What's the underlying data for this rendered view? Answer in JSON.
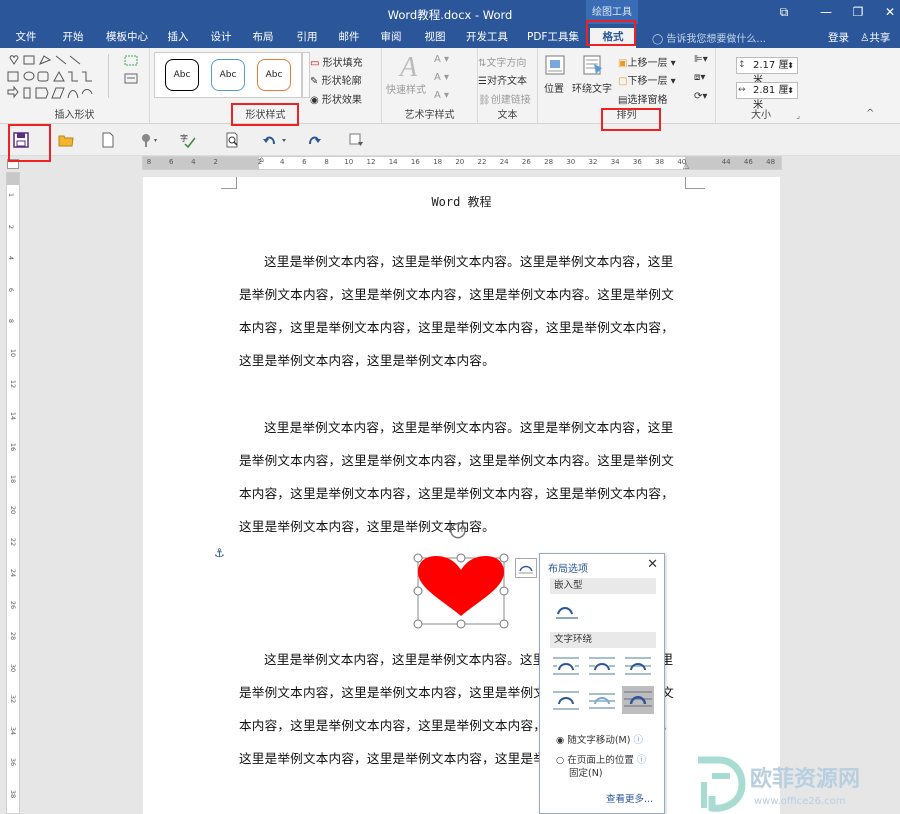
{
  "window": {
    "title": "Word教程.docx - Word",
    "contextual_tools": "绘图工具",
    "minimize": "—",
    "restore": "❐",
    "close": "✕",
    "ribbon_display": "⧉"
  },
  "tabs": [
    {
      "label": "文件"
    },
    {
      "label": "开始"
    },
    {
      "label": "模板中心"
    },
    {
      "label": "插入"
    },
    {
      "label": "设计"
    },
    {
      "label": "布局"
    },
    {
      "label": "引用"
    },
    {
      "label": "邮件"
    },
    {
      "label": "审阅"
    },
    {
      "label": "视图"
    },
    {
      "label": "开发工具"
    },
    {
      "label": "PDF工具集"
    },
    {
      "label": "格式"
    }
  ],
  "tell_me": "告诉我您想要做什么...",
  "account": {
    "login": "登录",
    "share": "共享"
  },
  "ribbon": {
    "insert_shapes": {
      "label": "插入形状"
    },
    "shape_styles": {
      "label": "形状样式",
      "style_preview": "Abc",
      "fill": "形状填充",
      "outline": "形状轮廓",
      "effects": "形状效果"
    },
    "wordart": {
      "label": "艺术字样式",
      "quick_styles": "快速样式"
    },
    "text": {
      "label": "文本",
      "direction": "文字方向",
      "align": "对齐文本",
      "link": "创建链接"
    },
    "arrange": {
      "label": "排列",
      "position": "位置",
      "wrap_text": "环绕文字",
      "bring_forward": "上移一层",
      "send_backward": "下移一层",
      "selection_pane": "选择窗格"
    },
    "size": {
      "label": "大小",
      "height": "2.17 厘米",
      "width": "2.81 厘米"
    }
  },
  "ruler": {
    "h_ticks": [
      "8",
      "6",
      "4",
      "2",
      "",
      "2",
      "4",
      "6",
      "8",
      "10",
      "12",
      "14",
      "16",
      "18",
      "20",
      "22",
      "24",
      "26",
      "28",
      "30",
      "32",
      "34",
      "36",
      "38",
      "40",
      "",
      "44",
      "46",
      "48"
    ],
    "v_ticks": [
      "1",
      "2",
      "4",
      "6",
      "8",
      "10",
      "12",
      "14",
      "16",
      "18",
      "20",
      "22",
      "24",
      "26",
      "28",
      "30",
      "32",
      "34",
      "36",
      "38"
    ]
  },
  "document": {
    "header": "Word 教程",
    "lines": [
      "这里是举例文本内容，这里是举例文本内容。这里是举例文本内容，这里",
      "是举例文本内容，这里是举例文本内容，这里是举例文本内容。这里是举例文",
      "本内容，这里是举例文本内容，这里是举例文本内容，这里是举例文本内容，",
      "这里是举例文本内容，这里是举例文本内容。",
      "这里是举例文本内容，这里是举例文本内容。这里是举例文本内容，这里",
      "是举例文本内容，这里是举例文本内容，这里是举例文本内容。这里是举例文",
      "本内容，这里是举例文本内容，这里是举例文本内容，这里是举例文本内容，",
      "这里是举例文本内容，这里是举例文本内容。",
      "这里是举例文本内容，这里是举例文本内容。这里是举例文本内容，这里",
      "是举例文本内容，这里是举例文本内容，这里是举例文本内容。这里是举例文",
      "本内容，这里是举例文本内容，这里是举例文本内容，这里是举例文本内容，",
      "这里是举例文本内容，这里是举例文本内容，这里是举例文本内容，"
    ]
  },
  "layout_options": {
    "title": "布局选项",
    "close": "✕",
    "inline_section": "嵌入型",
    "wrap_section": "文字环绕",
    "move_with_text": "随文字移动(M)",
    "fix_position_line1": "在页面上的位置",
    "fix_position_line2": "固定(N)",
    "see_more": "查看更多..."
  },
  "watermark": {
    "brand": "欧菲资源网",
    "url": "www.office26.com"
  },
  "colors": {
    "word_blue": "#2b579a",
    "heart": "#ff0000",
    "highlight": "#e22222"
  }
}
